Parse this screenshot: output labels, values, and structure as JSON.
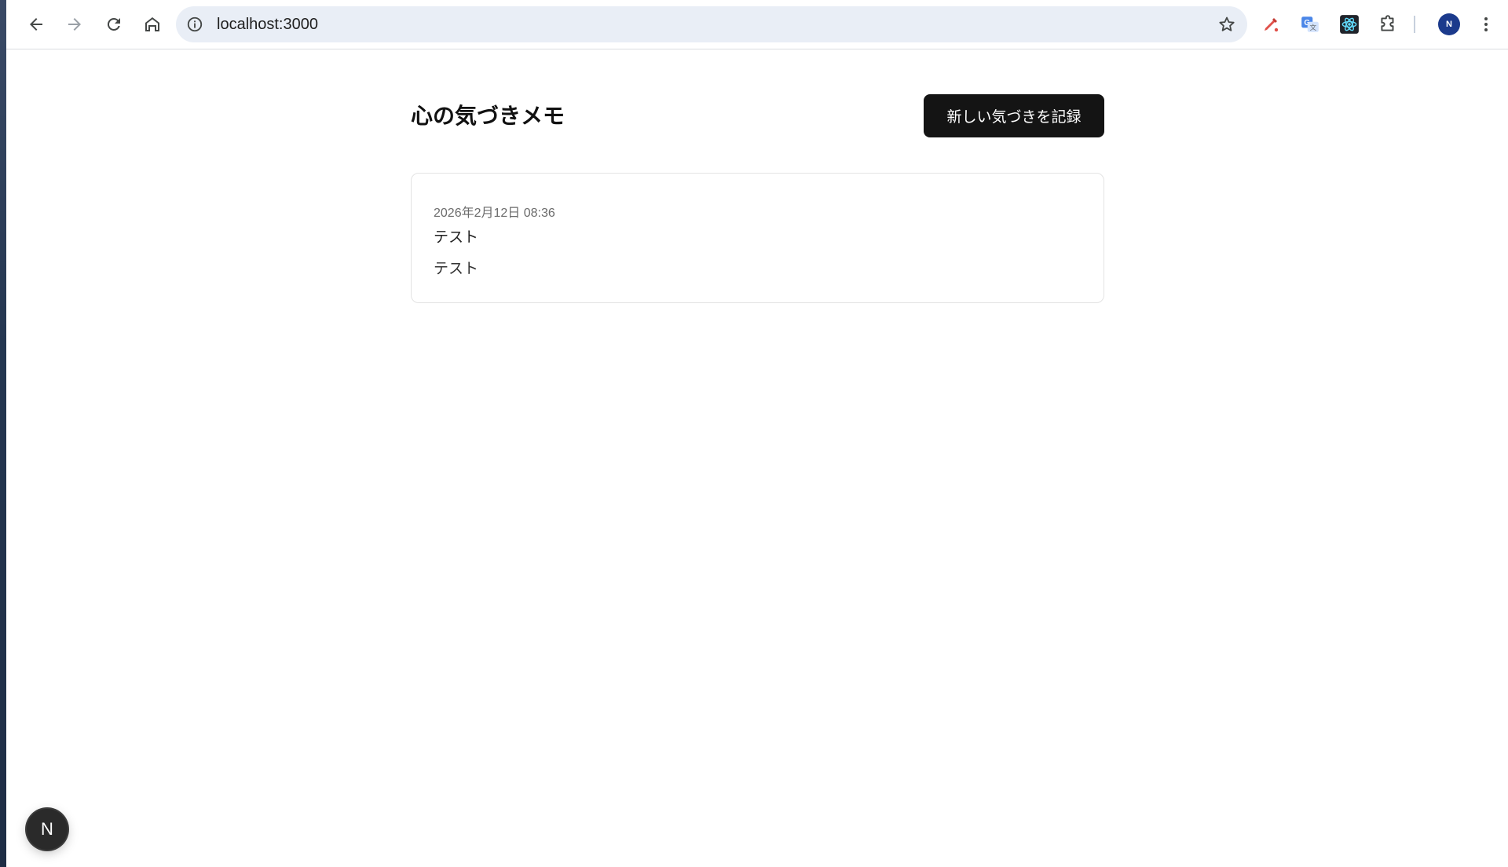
{
  "browser": {
    "url": "localhost:3000",
    "profile_initial": "N",
    "icons": {
      "back": "arrow-left-icon",
      "forward": "arrow-right-icon",
      "reload": "reload-icon",
      "home": "home-icon",
      "site_info": "info-icon",
      "bookmark": "star-icon",
      "extensions": [
        "pen-tool-icon",
        "translate-icon",
        "react-devtools-icon",
        "puzzle-icon"
      ],
      "menu": "kebab-menu-icon"
    }
  },
  "page": {
    "title": "心の気づきメモ",
    "new_button_label": "新しい気づきを記録"
  },
  "entries": [
    {
      "date": "2026年2月12日 08:36",
      "title": "テスト",
      "body": "テスト"
    }
  ],
  "dev_badge": {
    "label": "N"
  },
  "colors": {
    "primary_button": "#141414",
    "card_border": "#e3e3e3",
    "omnibox": "#e9eef6",
    "avatar": "#1b3a8c"
  }
}
